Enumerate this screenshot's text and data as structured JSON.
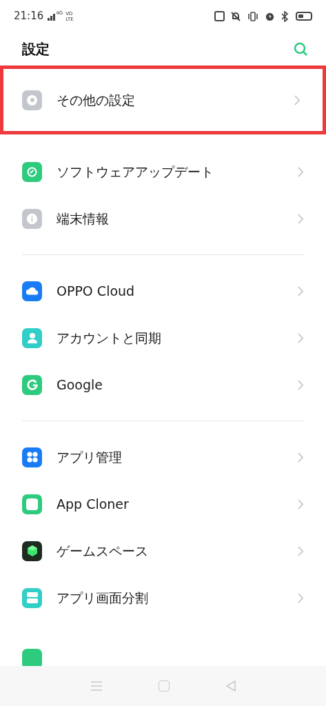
{
  "status_bar": {
    "time": "21:16",
    "network": "4G",
    "volte_top": "VO",
    "volte_bottom": "LTE"
  },
  "header": {
    "title": "設定"
  },
  "groups": [
    {
      "items": [
        {
          "label": "その他の設定",
          "kind": "gear",
          "highlighted": true
        }
      ]
    },
    {
      "items": [
        {
          "label": "ソフトウェアアップデート",
          "kind": "update",
          "highlighted": false
        },
        {
          "label": "端末情報",
          "kind": "info",
          "highlighted": false
        }
      ]
    },
    {
      "items": [
        {
          "label": "OPPO Cloud",
          "kind": "cloud",
          "highlighted": false
        },
        {
          "label": "アカウントと同期",
          "kind": "account",
          "highlighted": false
        },
        {
          "label": "Google",
          "kind": "google",
          "highlighted": false
        }
      ]
    },
    {
      "items": [
        {
          "label": "アプリ管理",
          "kind": "apps",
          "highlighted": false
        },
        {
          "label": "App Cloner",
          "kind": "cloner",
          "highlighted": false
        },
        {
          "label": "ゲームスペース",
          "kind": "game",
          "highlighted": false
        },
        {
          "label": "アプリ画面分割",
          "kind": "split",
          "highlighted": false
        }
      ]
    }
  ]
}
